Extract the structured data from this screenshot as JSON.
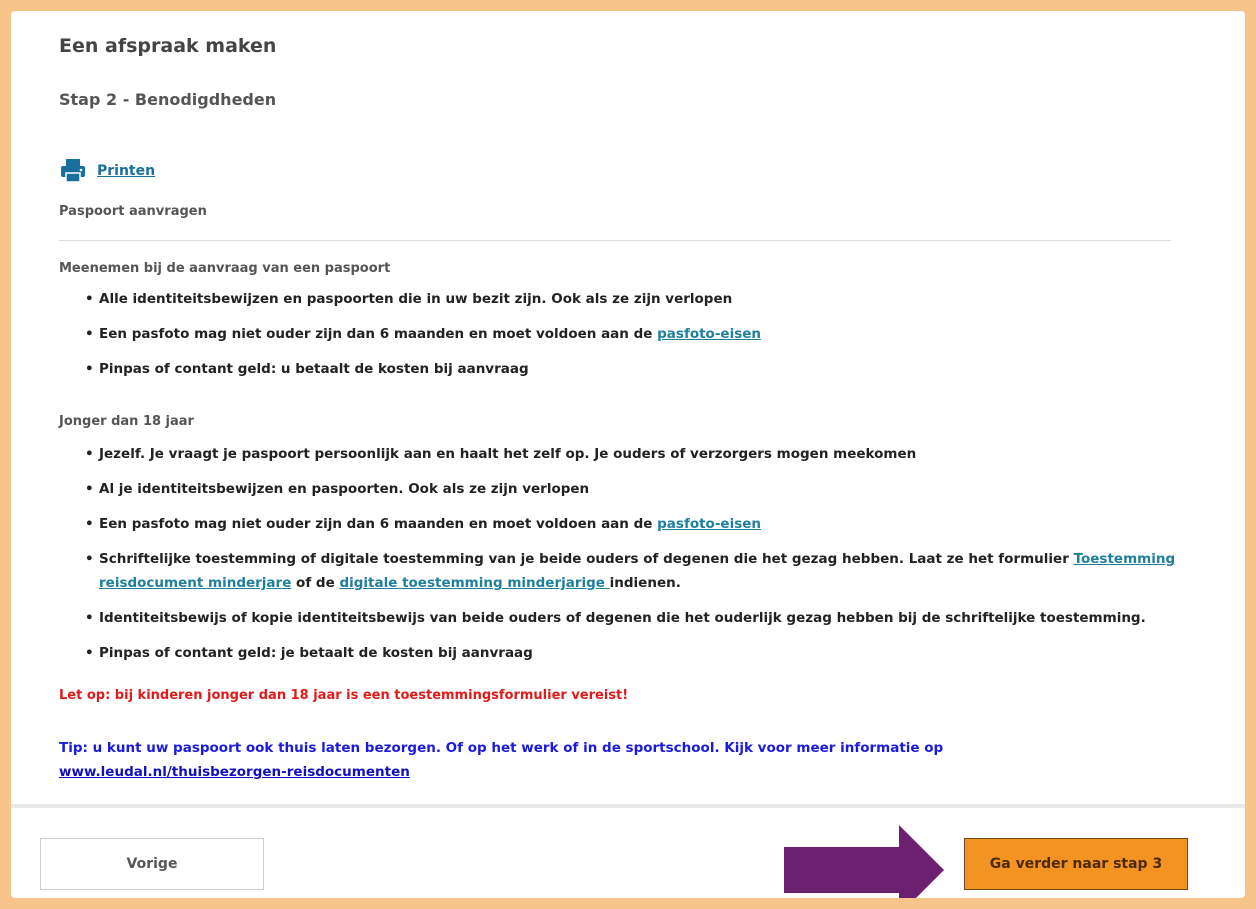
{
  "page": {
    "title": "Een afspraak maken",
    "subtitle": "Stap 2 - Benodigdheden",
    "print_label": "Printen",
    "section_title": "Paspoort aanvragen"
  },
  "adult": {
    "heading": "Meenemen bij de aanvraag van een paspoort",
    "item1": "Alle identiteitsbewijzen en paspoorten die in uw bezit zijn. Ook als ze zijn verlopen",
    "item2_text": "Een pasfoto mag niet ouder zijn dan 6 maanden en moet voldoen aan de ",
    "item2_link": "pasfoto-eisen",
    "item3": "Pinpas of contant geld: u betaalt de kosten bij aanvraag"
  },
  "minor": {
    "heading": "Jonger dan 18 jaar",
    "item1": "Jezelf. Je vraagt je paspoort persoonlijk aan en haalt het zelf op. Je ouders of verzorgers mogen meekomen",
    "item2": "Al je identiteitsbewijzen en paspoorten. Ook als ze zijn verlopen",
    "item3_text": "Een pasfoto mag niet ouder zijn dan 6 maanden en moet voldoen aan de ",
    "item3_link": "pasfoto-eisen",
    "item4_text_a": "Schriftelijke toestemming of digitale toestemming van je beide ouders of degenen die het gezag hebben. Laat ze het formulier ",
    "item4_link_a": "Toestemming reisdocument minderjare",
    "item4_text_b": " of de ",
    "item4_link_b": "digitale toestemming minderjarige ",
    "item4_text_c": "indienen.",
    "item5": "Identiteitsbewijs of kopie identiteitsbewijs van beide ouders of degenen die het ouderlijk gezag hebben bij de schriftelijke toestemming.",
    "item6": "Pinpas of contant geld: je betaalt de kosten bij aanvraag"
  },
  "warning": "Let op: bij kinderen jonger dan 18 jaar is een toestemmingsformulier vereist!",
  "tip": {
    "text": "Tip: u kunt uw paspoort ook thuis laten bezorgen. Of op het werk of in de sportschool. Kijk voor meer informatie op ",
    "link": "www.leudal.nl/thuisbezorgen-reisdocumenten"
  },
  "footer": {
    "prev_label": "Vorige",
    "next_label": "Ga verder naar stap 3"
  },
  "colors": {
    "frame": "#f7c48c",
    "link": "#1f7f9c",
    "warning": "#e01b1b",
    "tip": "#1a1ae0",
    "next_button": "#f39422",
    "arrow": "#6b2170"
  },
  "icons": {
    "print": "printer-icon",
    "arrow": "right-arrow-icon"
  }
}
